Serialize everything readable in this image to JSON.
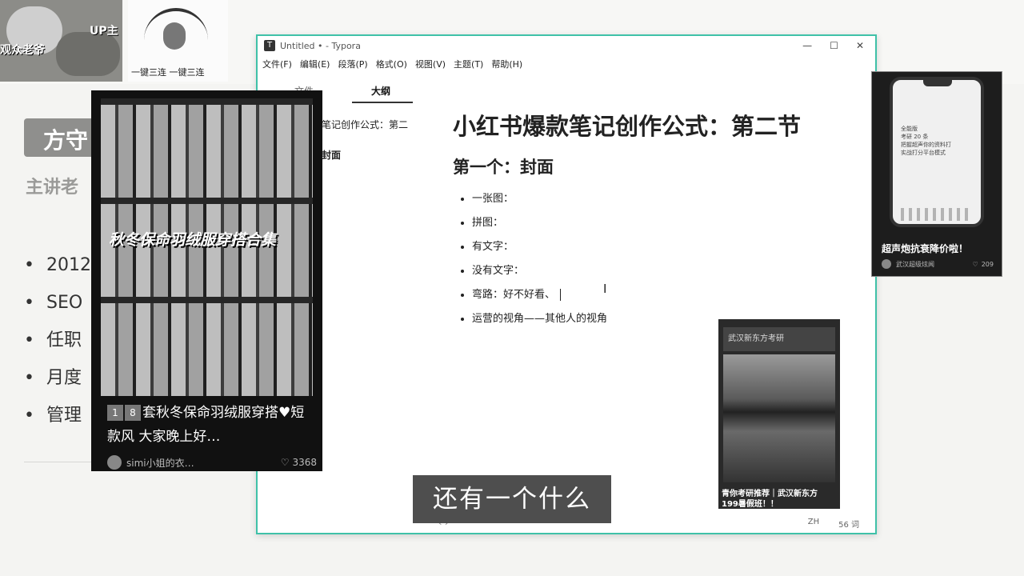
{
  "slide": {
    "thumb_left_text": "观众老爷",
    "thumb_right_text": "UP主",
    "meme_text": "一键三连 一键三连",
    "title_partial": "方守",
    "subtitle_partial": "主讲老",
    "bullets": [
      "2012",
      "SEO",
      "任职",
      "月度",
      "管理"
    ]
  },
  "typora": {
    "window_title": "Untitled • - Typora",
    "app_logo": "T",
    "controls": [
      "—",
      "☐",
      "✕"
    ],
    "menu": [
      "文件(F)",
      "编辑(E)",
      "段落(P)",
      "格式(O)",
      "视图(V)",
      "主题(T)",
      "帮助(H)"
    ],
    "sidebar": {
      "tab_files": "文件",
      "tab_outline": "大纲",
      "outline_items": [
        "笔记创作公式：第二",
        "封面"
      ]
    },
    "doc": {
      "h1": "小红书爆款笔记创作公式：第二节",
      "h2": "第一个：封面",
      "items": [
        "一张图：",
        "拼图：",
        "有文字：",
        "没有文字：",
        "弯路：好不好看、",
        "运营的视角——其他人的视角"
      ]
    },
    "status": {
      "lang": "ZH",
      "words": "56 词",
      "nav": "‹  ›"
    }
  },
  "photo_popup": {
    "overlay_text": "秋冬保命羽绒服穿搭合集",
    "badge_1": "1",
    "badge_2": "8",
    "caption": "套秋冬保命羽绒服穿搭♥短款风 大家晚上好…",
    "author": "simi小姐的衣…",
    "likes": "3368"
  },
  "phone_popup": {
    "screen_text": "全能版\n考研 20 条\n把握超声你的资料打\n实战打分平台模式",
    "title": "超声炮抗衰降价啦！",
    "author": "武汉超级炫闻",
    "likes": "209"
  },
  "ad_popup": {
    "header": "武汉新东方考研",
    "text_line1": "青你考研推荐｜武汉新东方",
    "text_line2": "199暑假班！！"
  },
  "subtitle_text": "还有一个什么"
}
